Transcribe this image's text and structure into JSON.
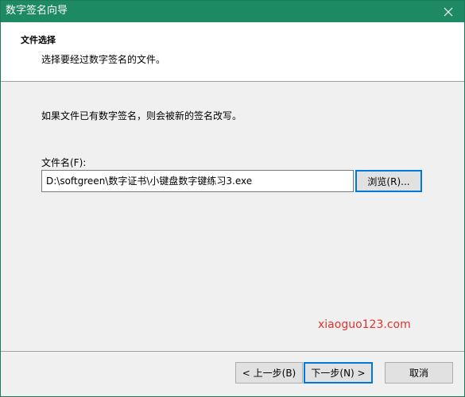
{
  "window": {
    "title": "数字签名向导",
    "accent": "#1d8a63"
  },
  "header": {
    "title": "文件选择",
    "description": "选择要经过数字签名的文件。"
  },
  "body": {
    "info": "如果文件已有数字签名，则会被新的签名改写。",
    "file_label": "文件名(F):",
    "file_value": "D:\\softgreen\\数字证书\\小键盘数字键练习3.exe",
    "browse_label": "浏览(R)..."
  },
  "watermark": {
    "text": "xiaoguo123.com",
    "color": "#e0322c"
  },
  "footer": {
    "back_label": "< 上一步(B)",
    "next_label": "下一步(N) >",
    "cancel_label": "取消"
  },
  "icons": {
    "close": "close-icon"
  }
}
